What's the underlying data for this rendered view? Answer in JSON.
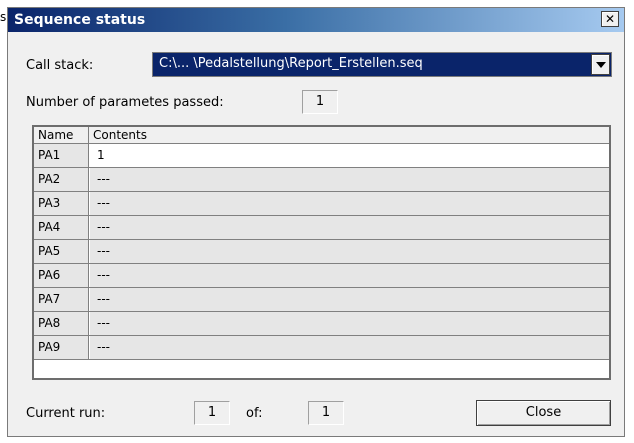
{
  "outside_glyph": "s",
  "window": {
    "title": "Sequence status",
    "close_symbol": "✕"
  },
  "call_stack": {
    "label": "Call stack:",
    "value": "C:\\... \\Pedalstellung\\Report_Erstellen.seq"
  },
  "params": {
    "label": "Number of parametes passed:",
    "count": "1"
  },
  "table": {
    "headers": [
      "Name",
      "Contents"
    ],
    "rows": [
      {
        "name": "PA1",
        "contents": "1"
      },
      {
        "name": "PA2",
        "contents": "---"
      },
      {
        "name": "PA3",
        "contents": "---"
      },
      {
        "name": "PA4",
        "contents": "---"
      },
      {
        "name": "PA5",
        "contents": "---"
      },
      {
        "name": "PA6",
        "contents": "---"
      },
      {
        "name": "PA7",
        "contents": "---"
      },
      {
        "name": "PA8",
        "contents": "---"
      },
      {
        "name": "PA9",
        "contents": "---"
      }
    ]
  },
  "run": {
    "label": "Current run:",
    "current": "1",
    "of_label": "of:",
    "total": "1"
  },
  "buttons": {
    "close": "Close"
  }
}
